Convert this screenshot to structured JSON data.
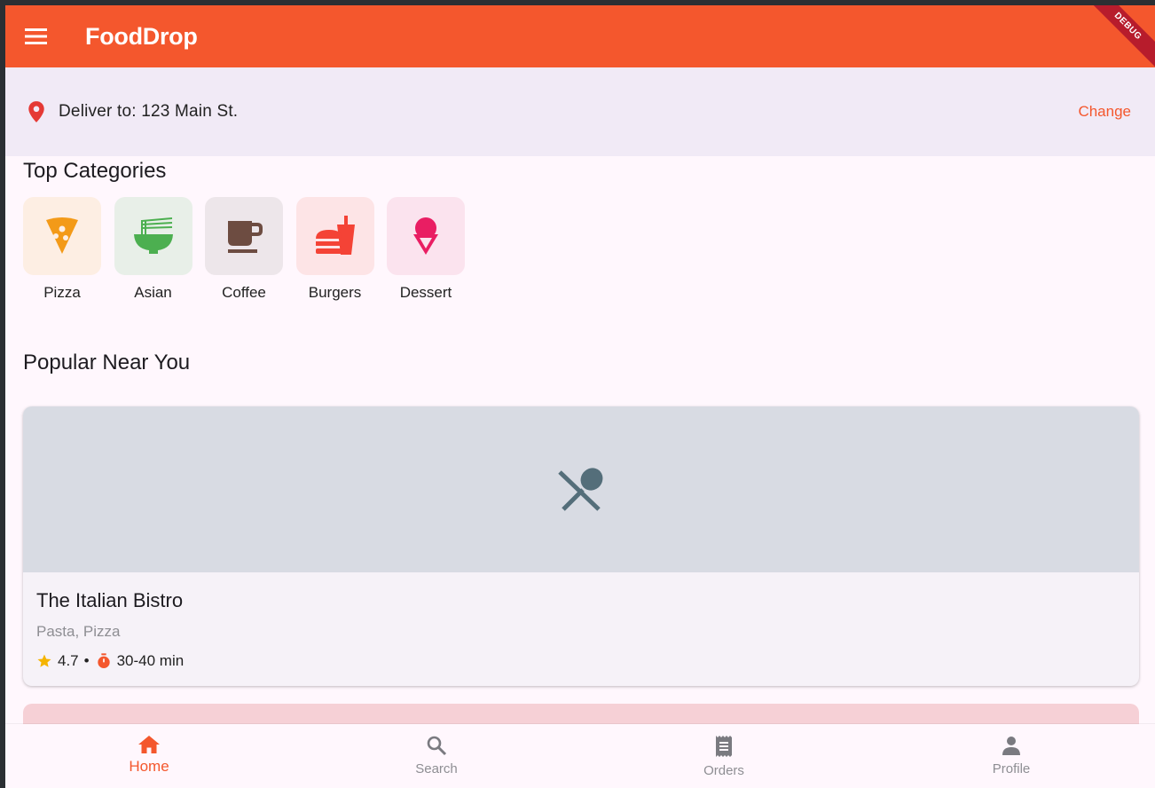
{
  "app": {
    "title": "FoodDrop",
    "debug_label": "DEBUG"
  },
  "delivery": {
    "text": "Deliver to: 123 Main St.",
    "change_label": "Change"
  },
  "categories_section": {
    "title": "Top Categories",
    "items": [
      {
        "label": "Pizza",
        "icon": "pizza-icon",
        "bg": "#fdeee3",
        "color": "#f39a18"
      },
      {
        "label": "Asian",
        "icon": "ramen-icon",
        "bg": "#e8efe8",
        "color": "#4caf50"
      },
      {
        "label": "Coffee",
        "icon": "coffee-icon",
        "bg": "#ede6ea",
        "color": "#6d4c41"
      },
      {
        "label": "Burgers",
        "icon": "fastfood-icon",
        "bg": "#fde4e6",
        "color": "#f44336"
      },
      {
        "label": "Dessert",
        "icon": "icecream-icon",
        "bg": "#fbe3ee",
        "color": "#e91e63"
      }
    ]
  },
  "popular_section": {
    "title": "Popular Near You",
    "restaurants": [
      {
        "name": "The Italian Bistro",
        "cuisine": "Pasta, Pizza",
        "rating": "4.7",
        "separator": "•",
        "time": "30-40 min",
        "image_icon": "restaurant-icon"
      }
    ]
  },
  "bottom_nav": {
    "items": [
      {
        "label": "Home",
        "icon": "home-icon",
        "active": true
      },
      {
        "label": "Search",
        "icon": "search-icon",
        "active": false
      },
      {
        "label": "Orders",
        "icon": "receipt-icon",
        "active": false
      },
      {
        "label": "Profile",
        "icon": "person-icon",
        "active": false
      }
    ]
  },
  "colors": {
    "primary": "#f4572d",
    "background": "#fff7fd",
    "delivery_bar": "#f1eaf6",
    "star": "#f5b400"
  }
}
